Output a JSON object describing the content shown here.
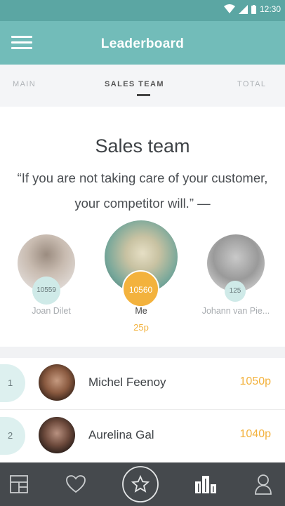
{
  "status_bar": {
    "time": "12:30"
  },
  "app_bar": {
    "title": "Leaderboard",
    "menu_icon": "hamburger-menu-icon"
  },
  "tabs": [
    {
      "label": "MAIN",
      "active": false
    },
    {
      "label": "SALES TEAM",
      "active": true
    },
    {
      "label": "TOTAL",
      "active": false
    }
  ],
  "heading": "Sales team",
  "quote": "“If you are not taking care of your customer, your competitor will.” —",
  "podium": [
    {
      "name": "Joan Dilet",
      "score": "10559"
    },
    {
      "name": "Me",
      "score": "10560",
      "points": "25p"
    },
    {
      "name": "Johann van Pie...",
      "score": "125"
    }
  ],
  "ranking": [
    {
      "rank": "1",
      "name": "Michel Feenoy",
      "score": "1050p"
    },
    {
      "rank": "2",
      "name": "Aurelina Gal",
      "score": "1040p"
    }
  ],
  "bottom_nav": [
    {
      "icon": "dashboard-grid-icon"
    },
    {
      "icon": "heart-icon"
    },
    {
      "icon": "star-icon",
      "highlighted": true
    },
    {
      "icon": "leaderboard-bars-icon",
      "active": true
    },
    {
      "icon": "profile-icon"
    }
  ],
  "colors": {
    "status_bar": "#5ba6a3",
    "app_bar": "#72bcb9",
    "accent": "#f3b23d",
    "bubble": "#cfeae8",
    "nav_bg": "#45494d"
  }
}
